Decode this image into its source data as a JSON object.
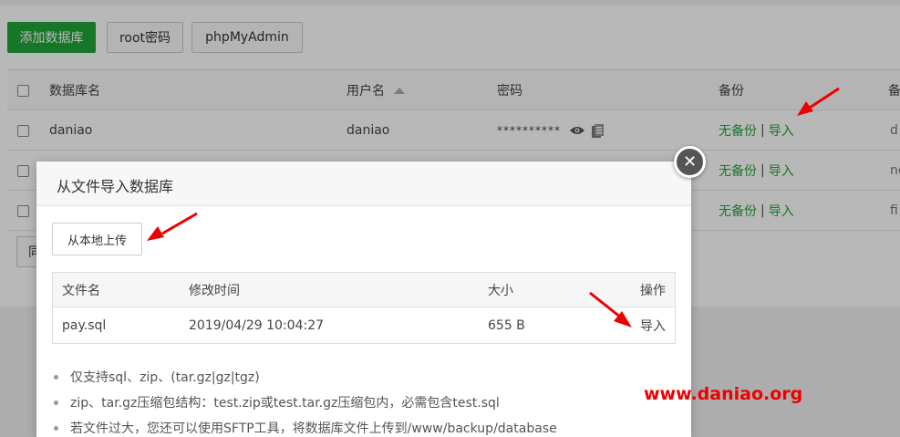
{
  "toolbar": {
    "add_db": "添加数据库",
    "root_pwd": "root密码",
    "phpmyadmin": "phpMyAdmin"
  },
  "table": {
    "headers": {
      "name": "数据库名",
      "user": "用户名",
      "password": "密码",
      "backup": "备份",
      "remark": "备"
    },
    "rows": [
      {
        "name": "daniao",
        "user": "daniao",
        "password": "**********",
        "backup": "无备份",
        "import": "导入",
        "remark": "d"
      },
      {
        "name": "",
        "user": "",
        "password": "",
        "backup": "无备份",
        "import": "导入",
        "remark": "ne"
      },
      {
        "name": "",
        "user": "",
        "password": "",
        "backup": "无备份",
        "import": "导入",
        "remark": "fi"
      }
    ],
    "pager_label": "同"
  },
  "dialog": {
    "title": "从文件导入数据库",
    "upload_label": "从本地上传",
    "file_table": {
      "headers": {
        "filename": "文件名",
        "modified": "修改时间",
        "size": "大小",
        "action": "操作"
      },
      "rows": [
        {
          "filename": "pay.sql",
          "modified": "2019/04/29 10:04:27",
          "size": "655 B",
          "action": "导入"
        }
      ]
    },
    "notes": [
      "仅支持sql、zip、(tar.gz|gz|tgz)",
      "zip、tar.gz压缩包结构：test.zip或test.tar.gz压缩包内，必需包含test.sql",
      "若文件过大，您还可以使用SFTP工具，将数据库文件上传到/www/backup/database"
    ],
    "close_symbol": "✕"
  },
  "watermark": "www.daniao.org",
  "colors": {
    "accent": "#20a53a",
    "arrow": "#e00000"
  }
}
